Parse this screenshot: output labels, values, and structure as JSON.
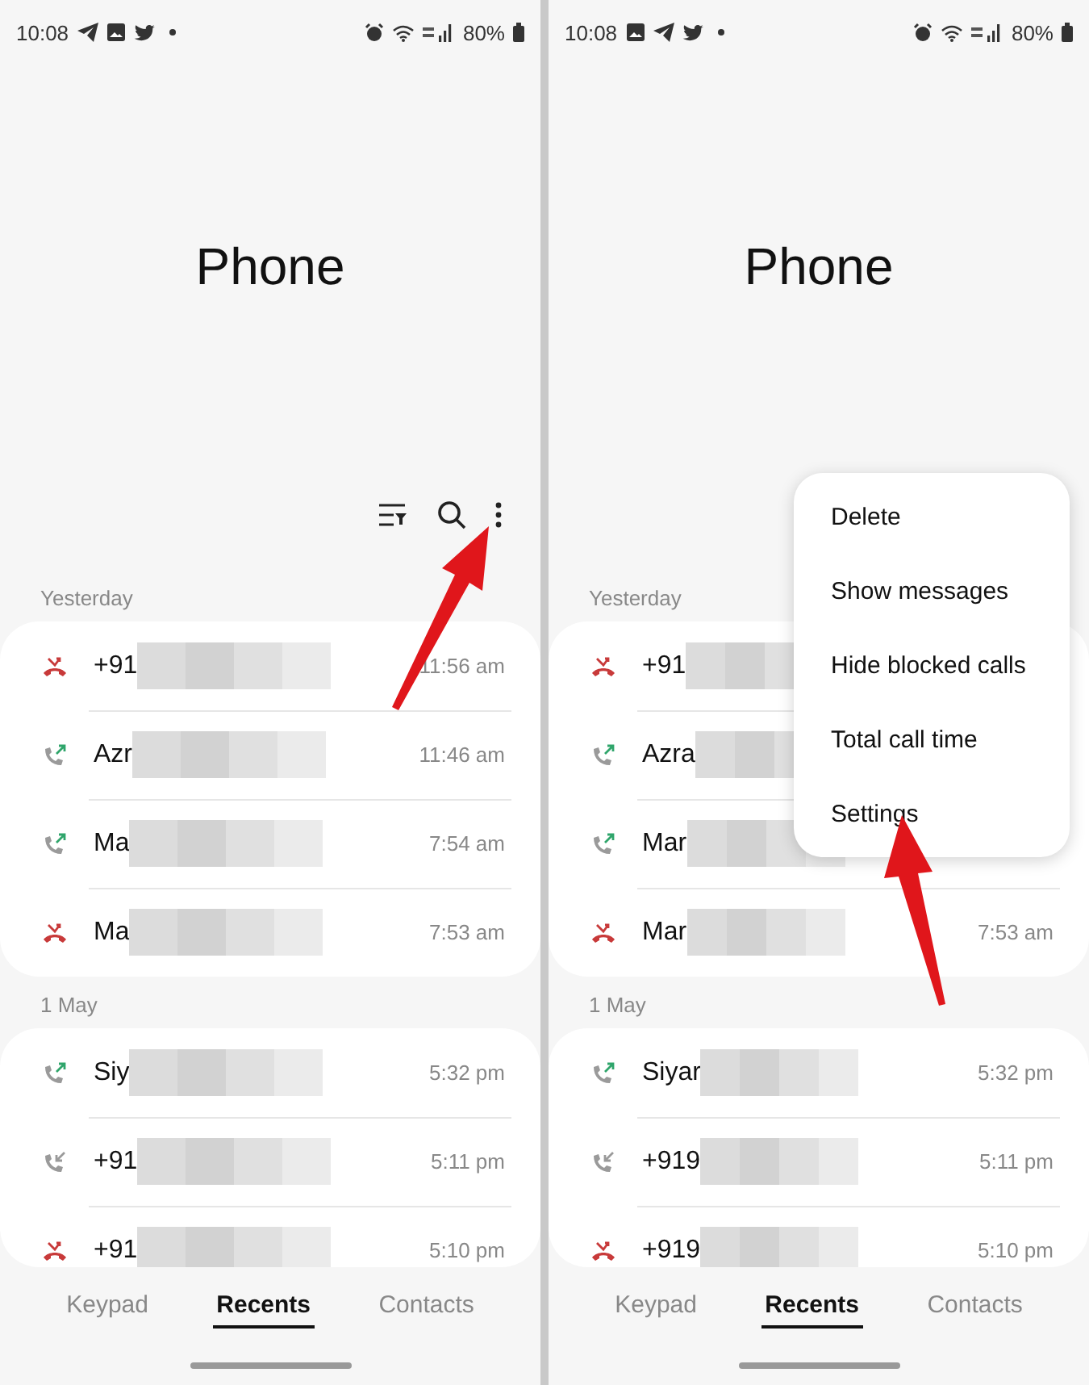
{
  "screens": [
    {
      "status_bar": {
        "time": "10:08",
        "notifications": [
          {
            "kind": "send"
          },
          {
            "kind": "image"
          },
          {
            "kind": "bird"
          }
        ],
        "battery": "80%"
      },
      "title": "Phone",
      "sections": [
        {
          "heading": "Yesterday",
          "calls": [
            {
              "kind": "missed",
              "name": "+91",
              "time": "11:56 am"
            },
            {
              "kind": "outgoing",
              "name": "Azr",
              "time": "11:46 am"
            },
            {
              "kind": "outgoing",
              "name": "Ma",
              "time": "7:54 am"
            },
            {
              "kind": "missed",
              "name": "Ma",
              "time": "7:53 am"
            }
          ]
        },
        {
          "heading": "1 May",
          "calls": [
            {
              "kind": "outgoing",
              "name": "Siy",
              "time": "5:32 pm"
            },
            {
              "kind": "incoming",
              "name": "+91",
              "time": "5:11 pm"
            },
            {
              "kind": "missed",
              "name": "+91",
              "time": "5:10 pm"
            }
          ]
        }
      ],
      "tabs": [
        {
          "label": "Keypad",
          "selected": false
        },
        {
          "label": "Recents",
          "selected": true
        },
        {
          "label": "Contacts",
          "selected": false
        }
      ]
    },
    {
      "status_bar": {
        "time": "10:08",
        "notifications": [
          {
            "kind": "image"
          },
          {
            "kind": "send"
          },
          {
            "kind": "bird"
          }
        ],
        "battery": "80%"
      },
      "title": "Phone",
      "menu": [
        "Delete",
        "Show messages",
        "Hide blocked calls",
        "Total call time",
        "Settings"
      ],
      "sections": [
        {
          "heading": "Yesterday",
          "calls": [
            {
              "kind": "missed",
              "name": "+91"
            },
            {
              "kind": "outgoing",
              "name": "Azra"
            },
            {
              "kind": "outgoing",
              "name": "Mar"
            },
            {
              "kind": "missed",
              "name": "Mar",
              "time": "7:53 am"
            }
          ]
        },
        {
          "heading": "1 May",
          "calls": [
            {
              "kind": "outgoing",
              "name": "Siyar",
              "time": "5:32 pm"
            },
            {
              "kind": "incoming",
              "name": "+919",
              "time": "5:11 pm"
            },
            {
              "kind": "missed",
              "name": "+919",
              "time": "5:10 pm"
            }
          ]
        }
      ],
      "tabs": [
        {
          "label": "Keypad",
          "selected": false
        },
        {
          "label": "Recents",
          "selected": true
        },
        {
          "label": "Contacts",
          "selected": false
        }
      ]
    }
  ]
}
